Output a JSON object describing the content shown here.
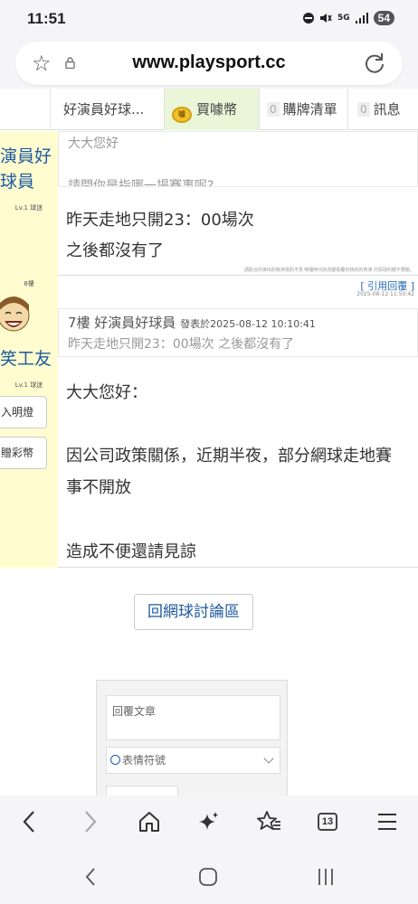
{
  "status_bar": {
    "time": "11:51",
    "network": "5G",
    "battery": "54"
  },
  "url_bar": {
    "url": "www.playsport.cc"
  },
  "tabs": {
    "user": "好演員好球...",
    "buy": "買噱幣",
    "coin_icon_text": "噱",
    "list_count": "0",
    "list": "購牌清單",
    "msg_count": "0",
    "msg": "訊息"
  },
  "post_prev": {
    "user_name_line1": "演員好",
    "user_name_line2": "球員",
    "level": "Lv.1 球迷",
    "quote_greeting": "大大您好",
    "quote_partial": "請問你是指哪一場賽事呢?",
    "body_line1": "昨天走地只開23：00場次",
    "body_line2": "之後都沒有了",
    "signature": "請配合你演出的我演視而不見 噴擾時代的改變看覆份核的的表演 打假球的都不要臉。"
  },
  "post_reply": {
    "floor": "8樓",
    "user_name": "笑工友",
    "level": "Lv.1 球迷",
    "btn_verify": "入明燈",
    "btn_gift": "贈彩幣",
    "quote_link": "[ 引用回覆 ]",
    "time": "2025-08-12 11:50:42",
    "quote_header_floor_user": "7樓 好演員好球員",
    "quote_header_posted": "發表於2025-08-12 10:10:41",
    "quote_body": "昨天走地只開23：00場次 之後都沒有了",
    "body_line1": "大大您好：",
    "body_line2": "因公司政策關係，近期半夜，部分網球走地賽",
    "body_line3": "事不開放",
    "body_line4": "造成不便還請見諒"
  },
  "back_forum": "回網球討論區",
  "reply_form": {
    "textarea_placeholder": "回覆文章",
    "emoji_label": "表情符號"
  },
  "toolbar": {
    "tabs_count": "13"
  },
  "colors": {
    "link_blue": "#1d5a9e",
    "sidebar_yellow": "#fffdd0",
    "buy_tab_green": "#e9f6d8"
  }
}
